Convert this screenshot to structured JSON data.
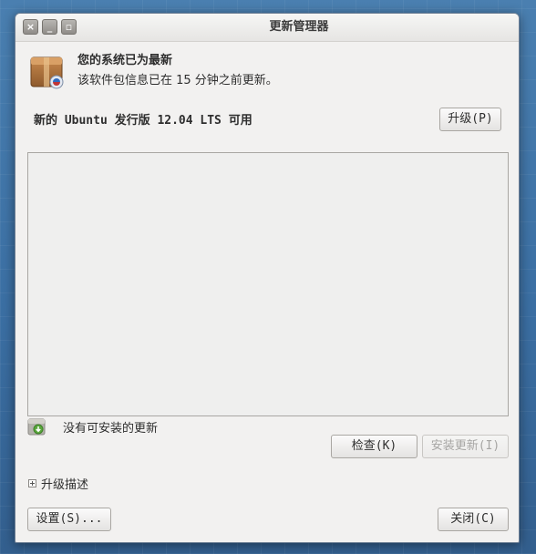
{
  "window": {
    "title": "更新管理器",
    "controls": {
      "close_glyph": "×",
      "minimize_glyph": "_",
      "maximize_glyph": "▫"
    }
  },
  "status": {
    "icon": "package-box-icon",
    "title": "您的系统已为最新",
    "subtitle": "该软件包信息已在 15 分钟之前更新。"
  },
  "release": {
    "text": "新的 Ubuntu 发行版 12.04 LTS 可用",
    "upgrade_button": "升级(P)"
  },
  "updates": {
    "items": [],
    "empty_icon": "download-package-icon",
    "empty_text": "没有可安装的更新"
  },
  "actions": {
    "check_button": "检查(K)",
    "install_button": "安装更新(I)",
    "install_enabled": false
  },
  "details": {
    "expander_label": "升级描述",
    "expanded": false
  },
  "footer": {
    "settings_button": "设置(S)...",
    "close_button": "关闭(C)"
  },
  "colors": {
    "desktop": "#3b6fa3",
    "window_bg": "#f2f1f0",
    "disabled_text": "#a6a5a3"
  }
}
